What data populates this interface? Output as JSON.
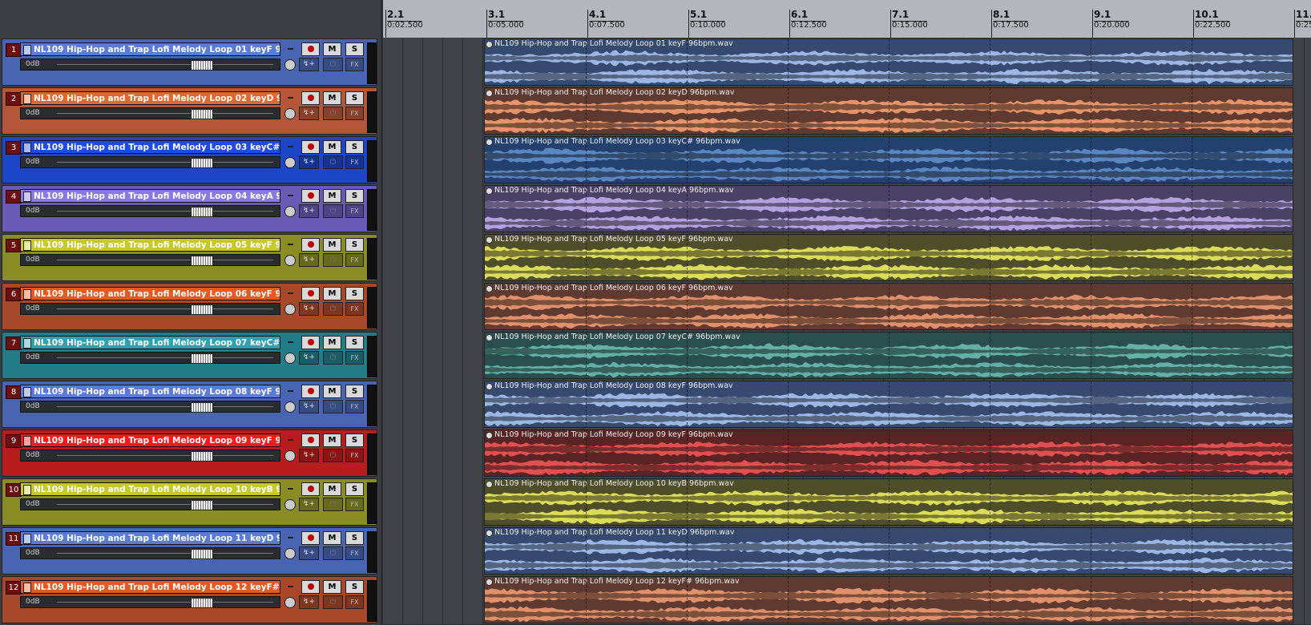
{
  "ruler": {
    "marks": [
      {
        "bar": "2.1",
        "time": "0:02.500"
      },
      {
        "bar": "3.1",
        "time": "0:05.000"
      },
      {
        "bar": "4.1",
        "time": "0:07.500"
      },
      {
        "bar": "5.1",
        "time": "0:10.000"
      },
      {
        "bar": "6.1",
        "time": "0:12.500"
      },
      {
        "bar": "7.1",
        "time": "0:15.000"
      },
      {
        "bar": "8.1",
        "time": "0:17.500"
      },
      {
        "bar": "9.1",
        "time": "0:20.000"
      },
      {
        "bar": "10.1",
        "time": "0:22.500"
      },
      {
        "bar": "11.",
        "time": "0:25"
      }
    ]
  },
  "tracks": [
    {
      "num": "1",
      "name": "NL109 Hip-Hop and Trap Lofi Melody Loop 01 keyF 96bpm",
      "item": "NL109 Hip-Hop and Trap Lofi Melody Loop 01 keyF 96bpm.wav",
      "volume": "0dB",
      "color": "#4a64b4",
      "wave": "#9cb7e6",
      "dark": "#36496e"
    },
    {
      "num": "2",
      "name": "NL109 Hip-Hop and Trap Lofi Melody Loop 02 keyD 96bpm",
      "item": "NL109 Hip-Hop and Trap Lofi Melody Loop 02 keyD 96bpm.wav",
      "volume": "0dB",
      "color": "#b4563a",
      "wave": "#e8946a",
      "dark": "#5e3a30"
    },
    {
      "num": "3",
      "name": "NL109 Hip-Hop and Trap Lofi Melody Loop 03 keyC# 96bpm",
      "item": "NL109 Hip-Hop and Trap Lofi Melody Loop 03 keyC# 96bpm.wav",
      "volume": "0dB",
      "color": "#1c45c8",
      "wave": "#5a86c2",
      "dark": "#23406e"
    },
    {
      "num": "4",
      "name": "NL109 Hip-Hop and Trap Lofi Melody Loop 04 keyA 96bpm",
      "item": "NL109 Hip-Hop and Trap Lofi Melody Loop 04 keyA 96bpm.wav",
      "volume": "0dB",
      "color": "#6a5ab8",
      "wave": "#b3a2e0",
      "dark": "#4a4266"
    },
    {
      "num": "5",
      "name": "NL109 Hip-Hop and Trap Lofi Melody Loop 05 keyF 96bpm",
      "item": "NL109 Hip-Hop and Trap Lofi Melody Loop 05 keyF 96bpm.wav",
      "volume": "0dB",
      "color": "#8a8c24",
      "wave": "#dcdc5a",
      "dark": "#4e4f2a"
    },
    {
      "num": "6",
      "name": "NL109 Hip-Hop and Trap Lofi Melody Loop 06 keyF 96bpm",
      "item": "NL109 Hip-Hop and Trap Lofi Melody Loop 06 keyF 96bpm.wav",
      "volume": "0dB",
      "color": "#a8482a",
      "wave": "#e0906a",
      "dark": "#5e3a30"
    },
    {
      "num": "7",
      "name": "NL109 Hip-Hop and Trap Lofi Melody Loop 07 keyC# 96bpm",
      "item": "NL109 Hip-Hop and Trap Lofi Melody Loop 07 keyC# 96bpm.wav",
      "volume": "0dB",
      "color": "#237d88",
      "wave": "#64b0a6",
      "dark": "#2a4d4e"
    },
    {
      "num": "8",
      "name": "NL109 Hip-Hop and Trap Lofi Melody Loop 08 keyF 96bpm",
      "item": "NL109 Hip-Hop and Trap Lofi Melody Loop 08 keyF 96bpm.wav",
      "volume": "0dB",
      "color": "#4a64b4",
      "wave": "#9cb7e6",
      "dark": "#36496e"
    },
    {
      "num": "9",
      "name": "NL109 Hip-Hop and Trap Lofi Melody Loop 09 keyF 96bpm",
      "item": "NL109 Hip-Hop and Trap Lofi Melody Loop 09 keyF 96bpm.wav",
      "volume": "0dB",
      "color": "#b81c1c",
      "wave": "#e05050",
      "dark": "#5a2424"
    },
    {
      "num": "10",
      "name": "NL109 Hip-Hop and Trap Lofi Melody Loop 10 keyB 96bpm",
      "item": "NL109 Hip-Hop and Trap Lofi Melody Loop 10 keyB 96bpm.wav",
      "volume": "0dB",
      "color": "#8a8c24",
      "wave": "#dcdc5a",
      "dark": "#4e4f2a"
    },
    {
      "num": "11",
      "name": "NL109 Hip-Hop and Trap Lofi Melody Loop 11 keyD 96bpm",
      "item": "NL109 Hip-Hop and Trap Lofi Melody Loop 11 keyD 96bpm.wav",
      "volume": "0dB",
      "color": "#4a64b4",
      "wave": "#9cb7e6",
      "dark": "#36496e"
    },
    {
      "num": "12",
      "name": "NL109 Hip-Hop and Trap Lofi Melody Loop 12 keyF# 96bpm",
      "item": "NL109 Hip-Hop and Trap Lofi Melody Loop 12 keyF# 96bpm.wav",
      "volume": "0dB",
      "color": "#a8482a",
      "wave": "#e0906a",
      "dark": "#5e3a30"
    }
  ],
  "labels": {
    "mute": "M",
    "solo": "S",
    "fx": "FX",
    "io": "↯+",
    "power": "⏻"
  },
  "name_colors": {
    "1": "#5b7bd6",
    "2": "#e0672e",
    "3": "#1f4be3",
    "4": "#8a7ae0",
    "5": "#c7c92a",
    "6": "#e45a24",
    "7": "#2ea2b0",
    "8": "#5b7bd6",
    "9": "#ff1a1a",
    "10": "#c7c92a",
    "11": "#5b7bd6",
    "12": "#e45a24"
  }
}
